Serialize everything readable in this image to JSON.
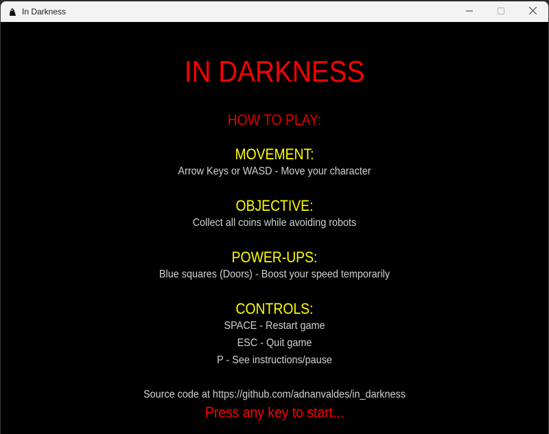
{
  "window": {
    "title": "In Darkness"
  },
  "game": {
    "title": "IN DARKNESS",
    "how_to_play": "HOW TO PLAY:",
    "sections": [
      {
        "heading": "MOVEMENT:",
        "lines": [
          "Arrow Keys or WASD - Move your character"
        ]
      },
      {
        "heading": "OBJECTIVE:",
        "lines": [
          "Collect all coins while avoiding robots"
        ]
      },
      {
        "heading": "POWER-UPS:",
        "lines": [
          "Blue squares (Doors) - Boost your speed temporarily"
        ]
      },
      {
        "heading": "CONTROLS:",
        "lines": [
          "SPACE - Restart game",
          "ESC - Quit game",
          "P - See instructions/pause"
        ]
      }
    ],
    "source": "Source code at https://github.com/adnanvaldes/in_darkness",
    "start_prompt": "Press any key to start..."
  },
  "colors": {
    "title": "#ff0000",
    "heading": "#ffff00",
    "body_text": "#d2d2d2",
    "background": "#000000"
  },
  "icons": {
    "app": "app-logo-icon",
    "minimize": "minimize-icon",
    "maximize": "maximize-icon",
    "close": "close-icon"
  }
}
